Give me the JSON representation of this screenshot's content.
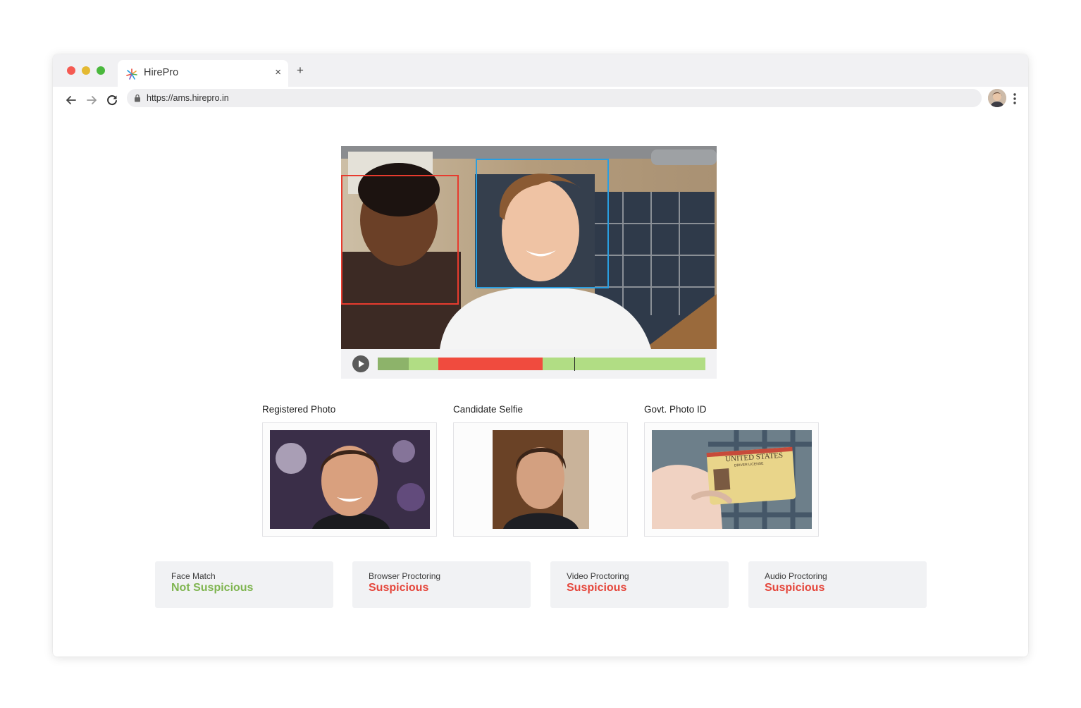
{
  "browser": {
    "tab_title": "HirePro",
    "tab_close": "×",
    "new_tab": "+",
    "url": "https://ams.hirepro.in"
  },
  "video": {
    "flagged_face_color": "#e73b2e",
    "candidate_face_color": "#2a9ee0",
    "timeline": {
      "base_color": "#b1dd84",
      "segments": [
        {
          "status": "watched",
          "color": "#8db36a",
          "start": 0.0,
          "end": 0.094
        },
        {
          "status": "clear",
          "color": "#b1dd84",
          "start": 0.094,
          "end": 0.185
        },
        {
          "status": "suspicious",
          "color": "#f04b3e",
          "start": 0.185,
          "end": 0.503
        },
        {
          "status": "clear",
          "color": "#b1dd84",
          "start": 0.503,
          "end": 1.0
        }
      ],
      "playhead": 0.6
    }
  },
  "photos": [
    {
      "label": "Registered Photo",
      "icon": "registered-photo-image"
    },
    {
      "label": "Candidate Selfie",
      "icon": "candidate-selfie-image"
    },
    {
      "label": "Govt. Photo ID",
      "icon": "govt-photo-id-image"
    }
  ],
  "id_card": {
    "country": "UNITED STATES",
    "type": "DRIVER LICENSE"
  },
  "status": [
    {
      "label": "Face Match",
      "value": "Not Suspicious",
      "color": "#7fb550"
    },
    {
      "label": "Browser Proctoring",
      "value": "Suspicious",
      "color": "#e5463b"
    },
    {
      "label": "Video Proctoring",
      "value": "Suspicious",
      "color": "#e5463b"
    },
    {
      "label": "Audio Proctoring",
      "value": "Suspicious",
      "color": "#e5463b"
    }
  ]
}
